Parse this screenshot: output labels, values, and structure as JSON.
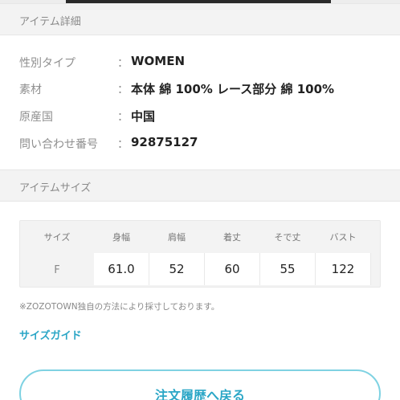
{
  "item_detail": {
    "header": "アイテム詳細",
    "rows": [
      {
        "label": "性別タイプ",
        "colon": "：",
        "value": "WOMEN"
      },
      {
        "label": "素材",
        "colon": "：",
        "value": "本体 綿 100% レース部分 綿 100%"
      },
      {
        "label": "原産国",
        "colon": "：",
        "value": "中国"
      },
      {
        "label": "問い合わせ番号",
        "colon": "：",
        "value": "92875127"
      }
    ]
  },
  "item_size": {
    "header": "アイテムサイズ",
    "table": {
      "columns": [
        "サイズ",
        "身幅",
        "肩幅",
        "着丈",
        "そで丈",
        "バスト"
      ],
      "rows": [
        [
          "F",
          "61.0",
          "52",
          "60",
          "55",
          "122"
        ]
      ]
    },
    "note": "※ZOZOTOWN独自の方法により採寸しております。",
    "size_guide_link": "サイズガイド"
  },
  "footer": {
    "back_button": "注文履歴へ戻る"
  },
  "colors": {
    "accent": "#2aa6c6",
    "button_border": "#7fd2e2",
    "header_bg": "#f3f3f3"
  }
}
